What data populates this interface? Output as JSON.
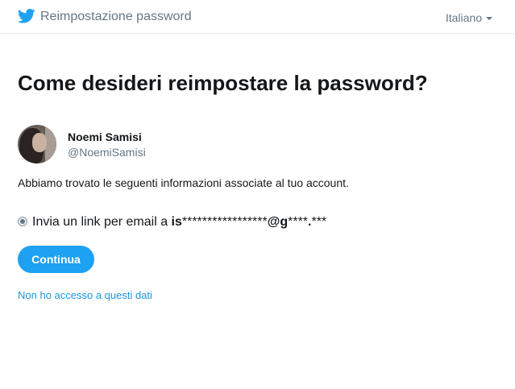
{
  "header": {
    "title": "Reimpostazione password",
    "logo_icon": "twitter-bird-icon",
    "language": "Italiano"
  },
  "main": {
    "heading": "Come desideri reimpostare la password?",
    "user": {
      "name": "Noemi Samisi",
      "handle": "@NoemiSamisi"
    },
    "info_text": "Abbiamo trovato le seguenti informazioni associate al tuo account.",
    "option": {
      "label_prefix": "Invia un link per email a ",
      "email_part1_bold": "is",
      "email_part2": "*****************",
      "email_part3_bold": "@g",
      "email_part4": "****",
      "email_part5_bold": ".",
      "email_part6": "***",
      "selected": true
    },
    "continue_label": "Continua",
    "no_access_link": "Non ho accesso a questi dati"
  },
  "colors": {
    "accent": "#1da1f2",
    "link": "#1b95e0",
    "muted": "#657786"
  }
}
